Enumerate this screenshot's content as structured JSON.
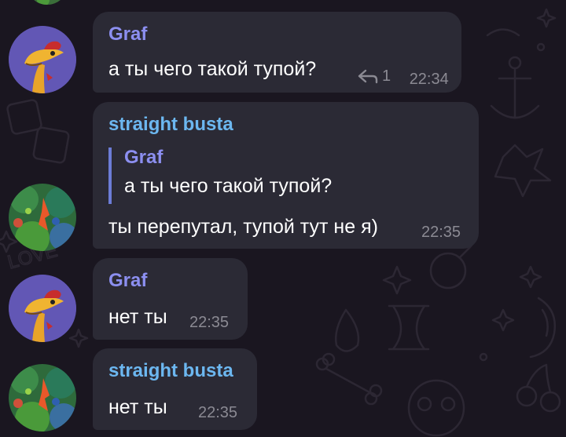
{
  "messages": [
    {
      "sender": "Graf",
      "sender_color": "#8c8ff0",
      "text": "а ты чего такой тупой?",
      "reply_count": "1",
      "time": "22:34",
      "avatar": "dinosaur-avatar"
    },
    {
      "sender": "straight busta",
      "sender_color": "#6cb7f0",
      "quote": {
        "sender": "Graf",
        "text": "а ты чего такой тупой?"
      },
      "text": "ты перепутал, тупой тут не я)",
      "time": "22:35",
      "avatar": "forest-avatar"
    },
    {
      "sender": "Graf",
      "sender_color": "#8c8ff0",
      "text": "нет ты",
      "time": "22:35",
      "avatar": "dinosaur-avatar"
    },
    {
      "sender": "straight busta",
      "sender_color": "#6cb7f0",
      "text": "нет ты",
      "time": "22:35",
      "avatar": "forest-avatar"
    }
  ],
  "colors": {
    "background": "#1a1620",
    "bubble": "#2b2a35",
    "quote_bar": "#6c7cd6",
    "meta": "#8b8a93"
  }
}
